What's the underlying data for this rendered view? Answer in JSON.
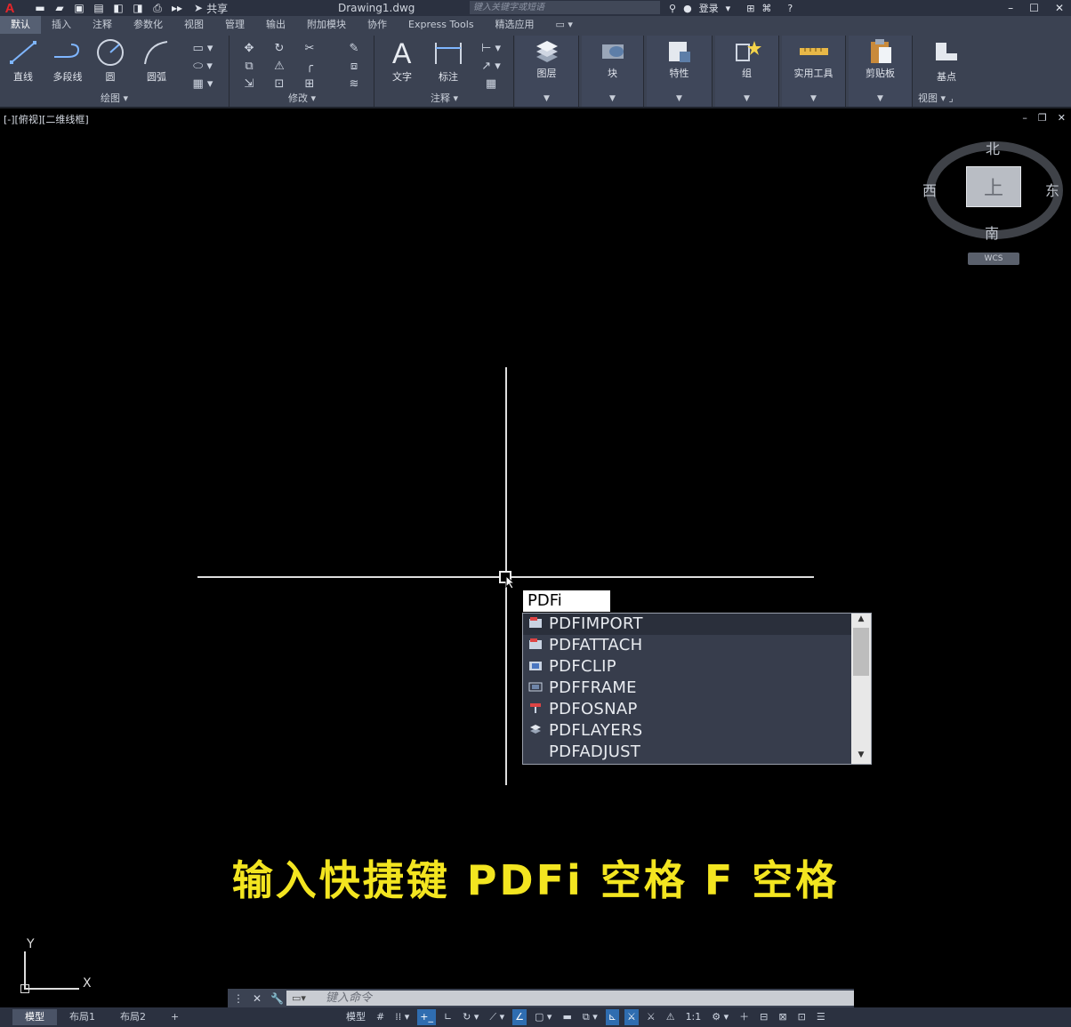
{
  "titlebar": {
    "logo": "A",
    "share_label": "共享",
    "document_name": "Drawing1.dwg",
    "search_placeholder": "键入关键字或短语",
    "signin_label": "登录"
  },
  "tabs": [
    "默认",
    "插入",
    "注释",
    "参数化",
    "视图",
    "管理",
    "输出",
    "附加模块",
    "协作",
    "Express Tools",
    "精选应用"
  ],
  "ribbon": {
    "draw_panel": {
      "title": "绘图",
      "buttons": [
        "直线",
        "多段线",
        "圆",
        "圆弧"
      ]
    },
    "modify_panel": {
      "title": "修改"
    },
    "annotation_panel": {
      "title": "注释",
      "buttons": [
        "文字",
        "标注"
      ]
    },
    "layers_label": "图层",
    "block_label": "块",
    "properties_label": "特性",
    "groups_label": "组",
    "utilities_label": "实用工具",
    "clipboard_label": "剪贴板",
    "view_panel": {
      "title": "视图",
      "button": "基点"
    }
  },
  "viewport": {
    "label": "[-][俯视][二维线框]"
  },
  "viewcube": {
    "north": "北",
    "south": "南",
    "east": "东",
    "west": "西",
    "face": "上",
    "wcs": "WCS"
  },
  "dynamic_input": {
    "value": "PDFi"
  },
  "autocomplete": {
    "items": [
      "PDFIMPORT",
      "PDFATTACH",
      "PDFCLIP",
      "PDFFRAME",
      "PDFOSNAP",
      "PDFLAYERS",
      "PDFADJUST"
    ],
    "selected_index": 0
  },
  "caption": "输入快捷键 PDFi 空格 F 空格",
  "ucs": {
    "x_label": "X",
    "y_label": "Y"
  },
  "command_line": {
    "placeholder": "键入命令"
  },
  "statusbar": {
    "layout_tabs": [
      "模型",
      "布局1",
      "布局2"
    ],
    "add_tab": "+",
    "model_label": "模型",
    "scale_label": "1:1"
  },
  "colors": {
    "ribbon_bg": "#3b4252",
    "canvas_bg": "#000000",
    "caption_color": "#f3e520",
    "accent_blue": "#2f6db0"
  }
}
